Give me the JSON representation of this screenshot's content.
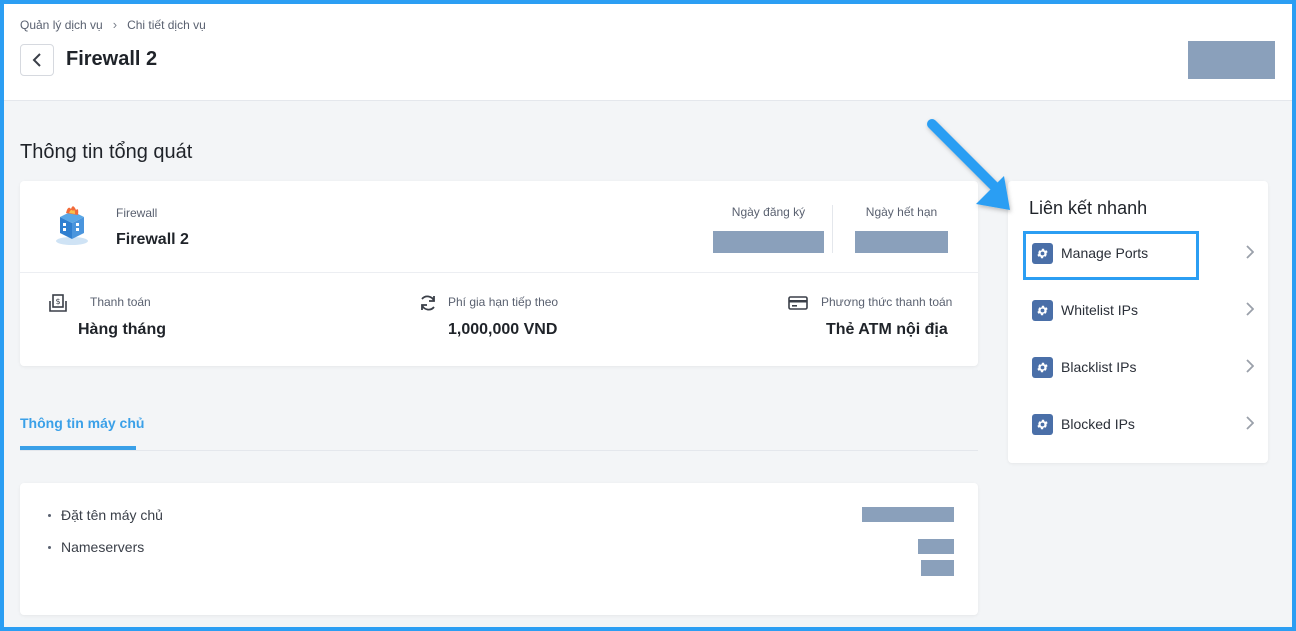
{
  "breadcrumb": {
    "parent": "Quản lý dịch vụ",
    "current": "Chi tiết dịch vụ"
  },
  "header": {
    "title": "Firewall 2"
  },
  "overview": {
    "section_title": "Thông tin tổng quát",
    "service_label": "Firewall",
    "service_name": "Firewall 2",
    "registered_label": "Ngày đăng ký",
    "expiry_label": "Ngày hết hạn",
    "billing_label": "Thanh toán",
    "billing_value": "Hàng tháng",
    "renewal_label": "Phí gia hạn tiếp theo",
    "renewal_value": "1,000,000 VND",
    "payment_label": "Phương thức thanh toán",
    "payment_value": "Thẻ ATM nội địa"
  },
  "tabs": {
    "active": "Thông tin máy chủ"
  },
  "server": {
    "hostname_label": "Đặt tên máy chủ",
    "nameservers_label": "Nameservers"
  },
  "quick_links": {
    "title": "Liên kết nhanh",
    "items": [
      {
        "label": "Manage Ports"
      },
      {
        "label": "Whitelist IPs"
      },
      {
        "label": "Blacklist IPs"
      },
      {
        "label": "Blocked IPs"
      }
    ]
  },
  "colors": {
    "accent": "#2b9ef3",
    "tab_active": "#3aa0e8",
    "redaction": "#8aa0bb",
    "gear_bg": "#4a6fa8"
  }
}
